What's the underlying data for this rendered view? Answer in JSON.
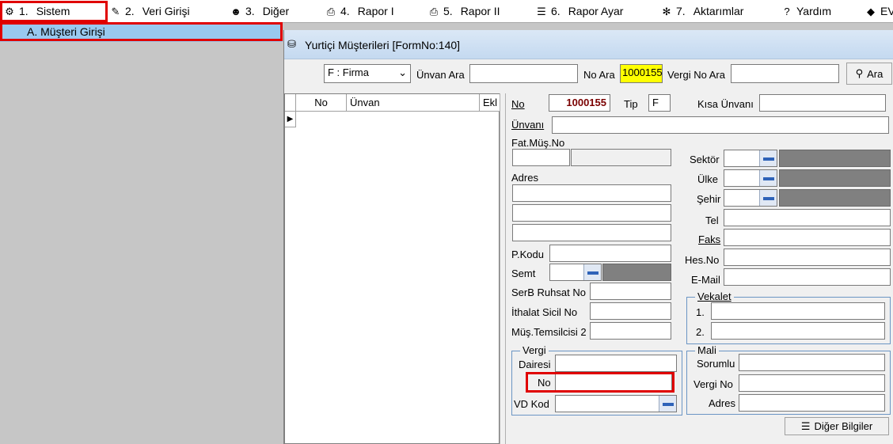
{
  "menu": {
    "items": [
      {
        "num": "1.",
        "label": "Sistem",
        "icon": "settings-icon"
      },
      {
        "num": "2.",
        "label": "Veri Girişi",
        "icon": "edit-icon"
      },
      {
        "num": "3.",
        "label": "Diğer",
        "icon": "people-icon"
      },
      {
        "num": "4.",
        "label": "Rapor I",
        "icon": "printer-icon"
      },
      {
        "num": "5.",
        "label": "Rapor II",
        "icon": "printer-icon"
      },
      {
        "num": "6.",
        "label": "Rapor Ayar",
        "icon": "report-settings-icon"
      },
      {
        "num": "7.",
        "label": "Aktarımlar",
        "icon": "transfer-icon"
      },
      {
        "num": "",
        "label": "Yardım",
        "icon": "help-icon"
      },
      {
        "num": "",
        "label": "EV",
        "icon": "book-icon"
      }
    ],
    "dropdown_item": "A.  Müşteri Girişi"
  },
  "form": {
    "title": "Yurtiçi Müşterileri [FormNo:140]",
    "filter": {
      "select_value": "F : Firma",
      "unvan_ara_label": "Ünvan Ara",
      "no_ara_label": "No Ara",
      "no_ara_value": "1000155",
      "vergi_no_ara_label": "Vergi No Ara",
      "search_button": "Ara"
    },
    "grid": {
      "columns": [
        "No",
        "Ünvan",
        "Ekl"
      ]
    },
    "fields": {
      "no_label": "No",
      "no_value": "1000155",
      "tip_label": "Tip",
      "tip_value": "F",
      "kisa_unvani_label": "Kısa Ünvanı",
      "unvani_label": "Ünvanı",
      "fat_mus_no_label": "Fat.Müş.No",
      "adres_label": "Adres",
      "pkodu_label": "P.Kodu",
      "semt_label": "Semt",
      "serb_ruhsat_label": "SerB Ruhsat No",
      "ithalat_sicil_label": "İthalat Sicil No",
      "mus_temsilcisi_label": "Müş.Temsilcisi 2",
      "sektor_label": "Sektör",
      "ulke_label": "Ülke",
      "sehir_label": "Şehir",
      "tel_label": "Tel",
      "faks_label": "Faks",
      "hes_no_label": "Hes.No",
      "email_label": "E-Mail"
    },
    "vekalet": {
      "caption": "Vekalet",
      "row1_label": "1.",
      "row2_label": "2."
    },
    "vergi": {
      "caption": "Vergi",
      "dairesi_label": "Dairesi",
      "no_label": "No",
      "vd_kod_label": "VD Kod"
    },
    "mali": {
      "caption": "Mali",
      "sorumlu_label": "Sorumlu",
      "vergi_no_label": "Vergi No",
      "adres_label": "Adres"
    },
    "diger_bilgiler_button": "Diğer Bilgiler"
  },
  "colors": {
    "highlight_red": "#e00000",
    "menu_selected": "#99c9ef",
    "no_value_color": "#7a0000",
    "search_highlight": "#ffff00"
  }
}
